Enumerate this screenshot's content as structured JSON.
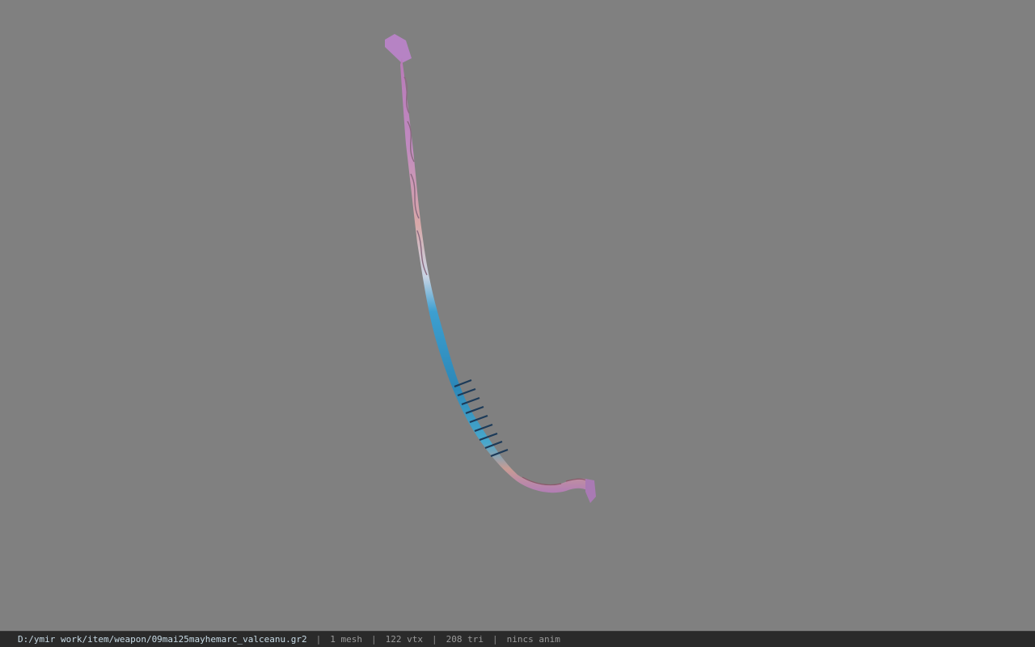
{
  "viewer": {
    "background_color": "#808080",
    "model_name": "bow"
  },
  "statusbar": {
    "file_path": "D:/ymir work/item/weapon/09mai25mayhemarc_valceanu.gr2",
    "separator": "|",
    "mesh_count": "1 mesh",
    "vertex_count": "122 vtx",
    "triangle_count": "208 tri",
    "anim_status": "nincs anim"
  }
}
